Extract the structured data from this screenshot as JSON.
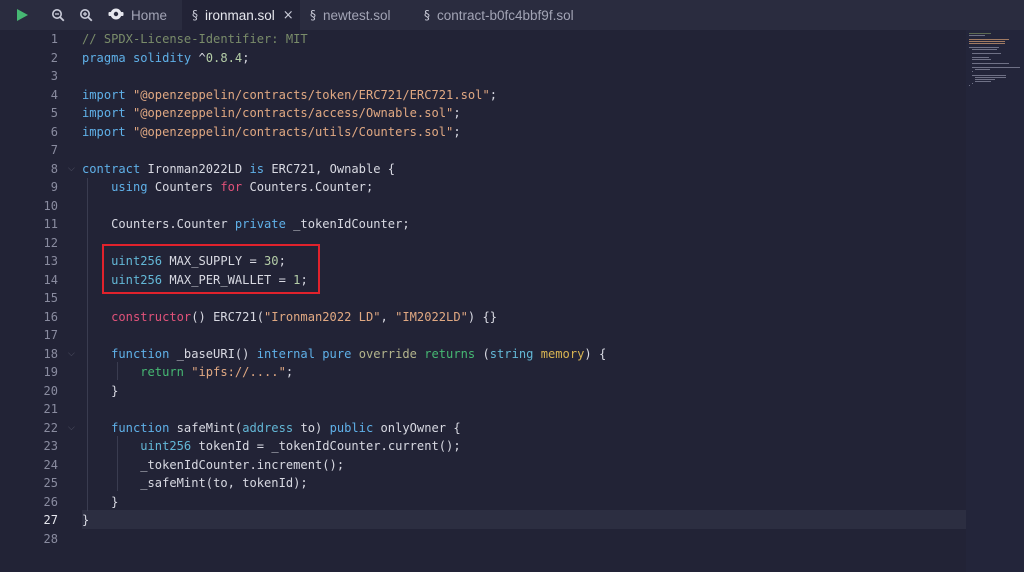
{
  "toolbar": {
    "run_icon": "play-icon",
    "zoom_out_icon": "zoom-out-icon",
    "zoom_in_icon": "zoom-in-icon"
  },
  "tabs": [
    {
      "label": "Home",
      "icon": "home-icon",
      "active": false
    },
    {
      "label": "ironman.sol",
      "icon": "file-icon",
      "active": true
    },
    {
      "label": "newtest.sol",
      "icon": "file-icon",
      "active": false
    },
    {
      "label": "contract-b0fc4bbf9f.sol",
      "icon": "file-icon",
      "active": false
    }
  ],
  "editor": {
    "current_line": 27,
    "line_numbers": [
      "1",
      "2",
      "3",
      "4",
      "5",
      "6",
      "7",
      "8",
      "9",
      "10",
      "11",
      "12",
      "13",
      "14",
      "15",
      "16",
      "17",
      "18",
      "19",
      "20",
      "21",
      "22",
      "23",
      "24",
      "25",
      "26",
      "27",
      "28"
    ],
    "lines": [
      "// SPDX-License-Identifier: MIT",
      "pragma solidity ^0.8.4;",
      "",
      "import \"@openzeppelin/contracts/token/ERC721/ERC721.sol\";",
      "import \"@openzeppelin/contracts/access/Ownable.sol\";",
      "import \"@openzeppelin/contracts/utils/Counters.sol\";",
      "",
      "contract Ironman2022LD is ERC721, Ownable {",
      "    using Counters for Counters.Counter;",
      "",
      "    Counters.Counter private _tokenIdCounter;",
      "",
      "    uint256 MAX_SUPPLY = 30;",
      "    uint256 MAX_PER_WALLET = 1;",
      "",
      "    constructor() ERC721(\"Ironman2022 LD\", \"IM2022LD\") {}",
      "",
      "    function _baseURI() internal pure override returns (string memory) {",
      "        return \"ipfs://....\";",
      "    }",
      "",
      "    function safeMint(address to) public onlyOwner {",
      "        uint256 tokenId = _tokenIdCounter.current();",
      "        _tokenIdCounter.increment();",
      "        _safeMint(to, tokenId);",
      "    }",
      "}",
      ""
    ]
  },
  "colors": {
    "background": "#222336",
    "toolbar": "#2a2c3f",
    "highlight_box": "#e0222c",
    "keyword": "#5fb0e8",
    "string": "#e0a882",
    "function": "#e1527a",
    "comment": "#7a8c6a"
  }
}
